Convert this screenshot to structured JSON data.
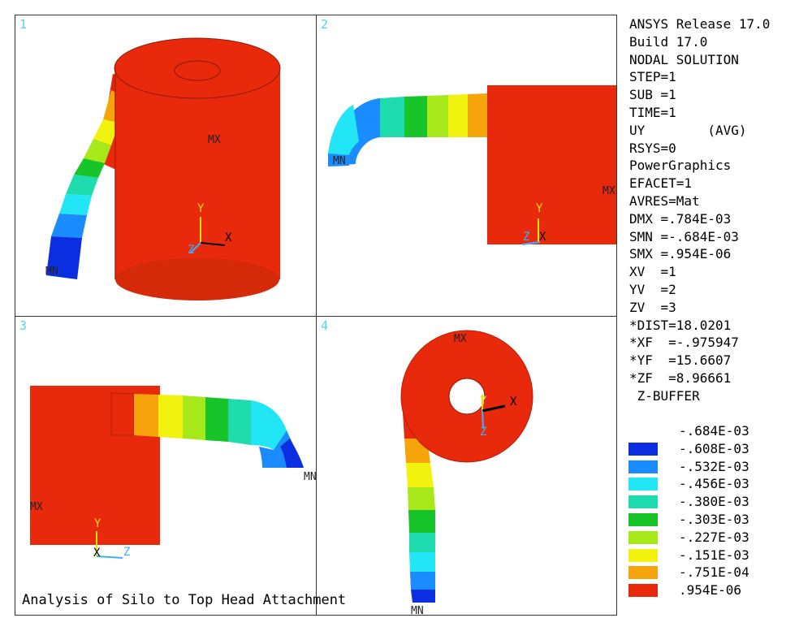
{
  "viewports": [
    {
      "number": "1",
      "labels": {
        "max": "MX",
        "min": "MN"
      },
      "axes": {
        "x": "X",
        "y": "Y",
        "z": "Z"
      }
    },
    {
      "number": "2",
      "labels": {
        "max": "MX",
        "min": "MN"
      },
      "axes": {
        "x": "X",
        "y": "Y",
        "z": "Z"
      }
    },
    {
      "number": "3",
      "labels": {
        "max": "MX",
        "min": "MN"
      },
      "axes": {
        "x": "X",
        "y": "Y",
        "z": "Z"
      }
    },
    {
      "number": "4",
      "labels": {
        "max": "MX",
        "min": "MN"
      },
      "axes": {
        "x": "X",
        "y": "Y",
        "z": "Z"
      }
    }
  ],
  "caption": "Analysis of Silo to Top Head Attachment",
  "info": [
    "ANSYS Release 17.0",
    "Build 17.0",
    "NODAL SOLUTION",
    "STEP=1",
    "SUB =1",
    "TIME=1",
    "UY        (AVG)",
    "RSYS=0",
    "PowerGraphics",
    "EFACET=1",
    "AVRES=Mat",
    "DMX =.784E-03",
    "SMN =-.684E-03",
    "SMX =.954E-06",
    "",
    "XV  =1",
    "YV  =2",
    "ZV  =3",
    "*DIST=18.0201",
    "*XF  =-.975947",
    "*YF  =15.6607",
    "*ZF  =8.96661",
    " Z-BUFFER"
  ],
  "legend": {
    "top_label": "-.684E-03",
    "bands": [
      {
        "color": "#0b2fe0",
        "label": "-.608E-03"
      },
      {
        "color": "#1a8cff",
        "label": "-.532E-03"
      },
      {
        "color": "#22e6f5",
        "label": "-.456E-03"
      },
      {
        "color": "#1fdcae",
        "label": "-.380E-03"
      },
      {
        "color": "#17c42a",
        "label": "-.303E-03"
      },
      {
        "color": "#a6e81a",
        "label": "-.227E-03"
      },
      {
        "color": "#f2f20f",
        "label": "-.151E-03"
      },
      {
        "color": "#f5a40c",
        "label": "-.751E-04"
      },
      {
        "color": "#e8290c",
        "label": ".954E-06"
      }
    ]
  },
  "colors": {
    "max_red": "#e8290c",
    "dark_red": "#b51f08",
    "viewport_number": "#4fd8e0",
    "axis_y": "#e6e600",
    "axis_z": "#3ab0ff"
  }
}
